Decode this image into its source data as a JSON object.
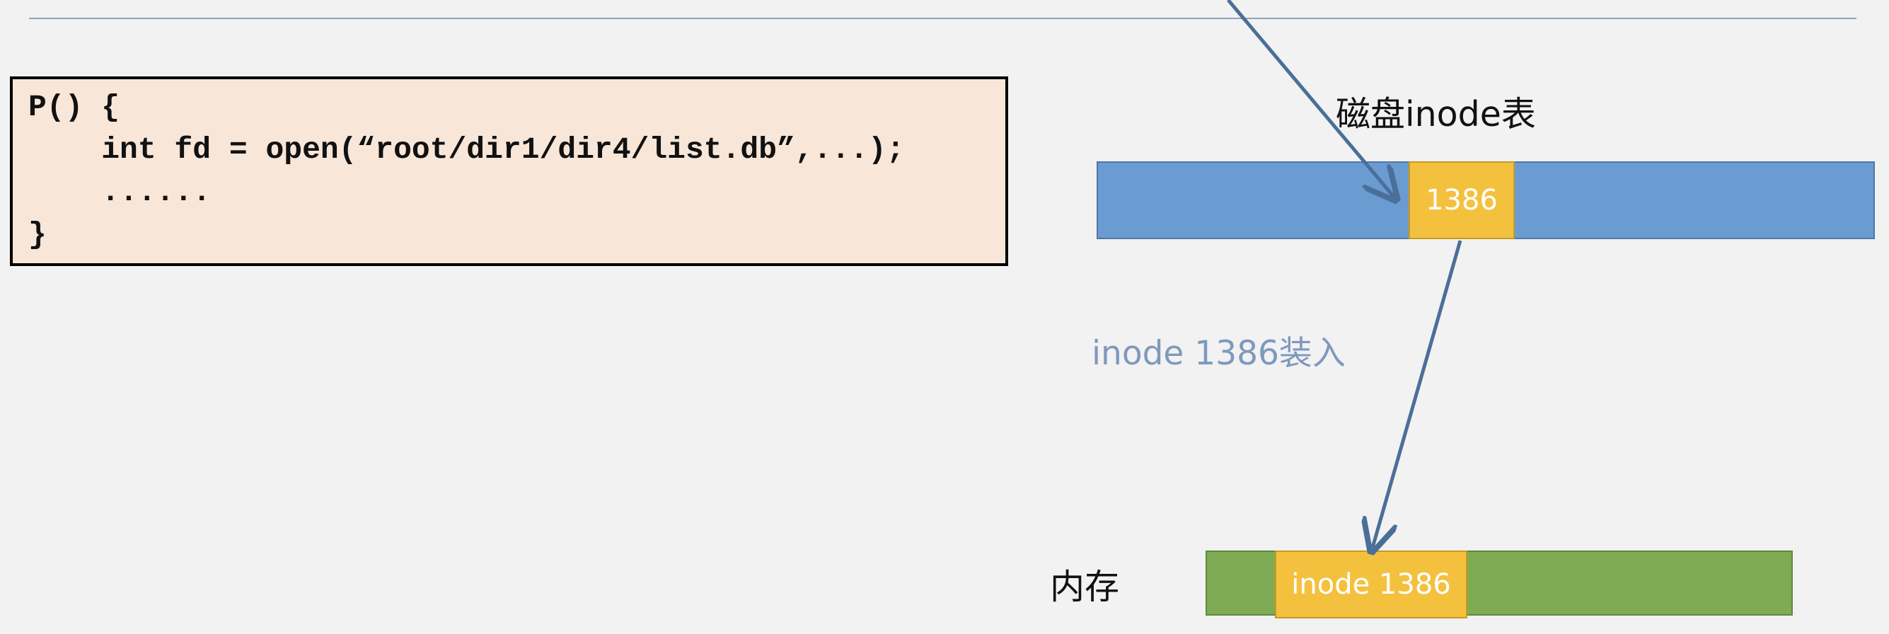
{
  "code": {
    "lines": [
      "P() {",
      "    int fd = open(“root/dir1/dir4/list.db”,...);",
      "    ......",
      "}"
    ]
  },
  "labels": {
    "disk_table": "磁盘inode表",
    "memory": "内存",
    "load_caption": "inode 1386装入"
  },
  "disk": {
    "slot_label": "1386"
  },
  "memory_bar": {
    "slot_label": "inode 1386"
  },
  "colors": {
    "background": "#f2f2f2",
    "code_fill": "#f8e6d8",
    "disk_bar": "#6a9bd1",
    "memory_bar": "#7fab54",
    "slot": "#f4c13f",
    "arrow": "#4a6f98",
    "caption": "#7f99bd"
  }
}
